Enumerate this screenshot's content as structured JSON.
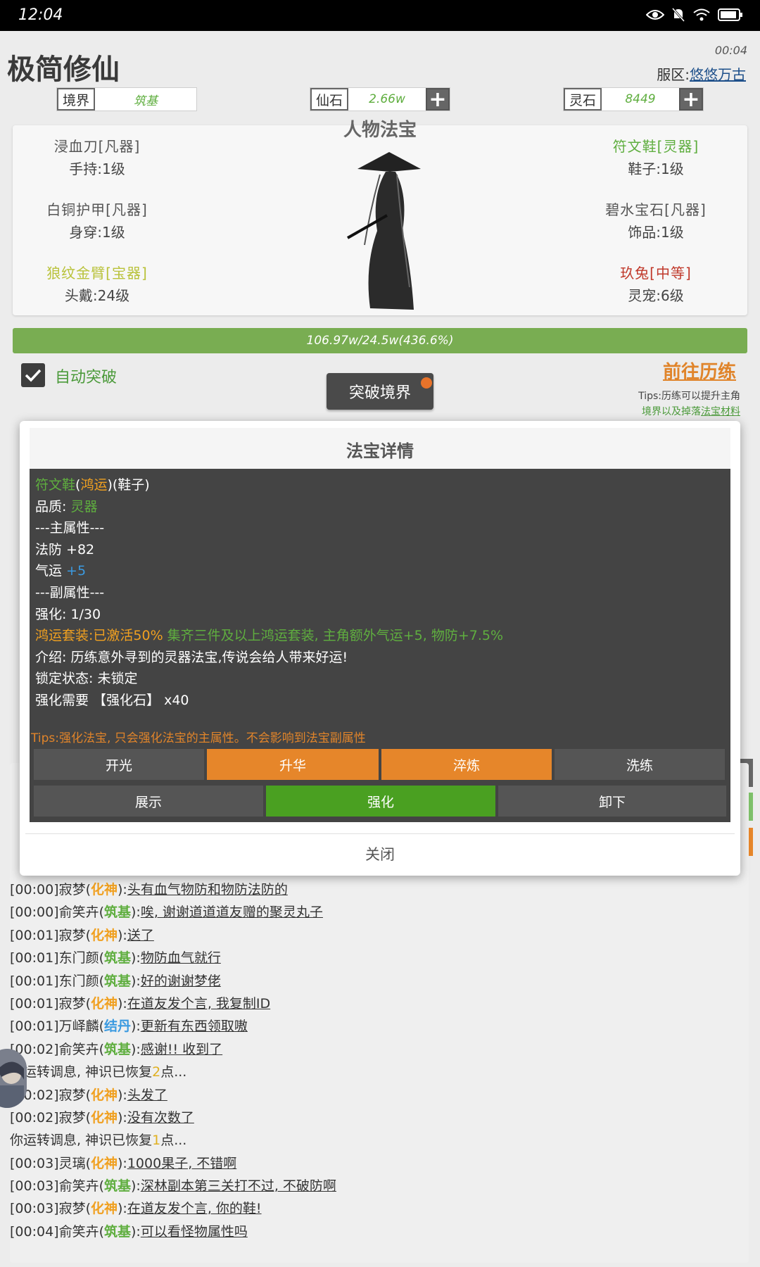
{
  "status_bar": {
    "time": "12:04"
  },
  "header": {
    "title": "极简修仙",
    "timer": "00:04",
    "server_label": "服区:",
    "server_name": "悠悠万古"
  },
  "resources": {
    "realm": {
      "label": "境界",
      "value": "筑基",
      "color": "#5fae3f"
    },
    "xian_stone": {
      "label": "仙石",
      "value": "2.66w",
      "color": "#5fae3f"
    },
    "ling_stone": {
      "label": "灵石",
      "value": "8449",
      "color": "#5fae3f"
    }
  },
  "equipment": {
    "title": "人物法宝",
    "items": [
      {
        "name": "浸血刀[凡器]",
        "slot": "手持:1级",
        "color": "#555555"
      },
      {
        "name": "白铜护甲[凡器]",
        "slot": "身穿:1级",
        "color": "#555555"
      },
      {
        "name": "狼纹金臂[宝器]",
        "slot": "头戴:24级",
        "color": "#b9c23a"
      },
      {
        "name": "符文鞋[灵器]",
        "slot": "鞋子:1级",
        "color": "#5fae3f"
      },
      {
        "name": "碧水宝石[凡器]",
        "slot": "饰品:1级",
        "color": "#555555"
      },
      {
        "name": "玖兔[中等]",
        "slot": "灵宠:6级",
        "color": "#c0392b"
      }
    ]
  },
  "progress": {
    "text": "106.97w/24.5w(436.6%)",
    "fraction": 1.0
  },
  "actions": {
    "auto_breakthrough": "自动突破",
    "auto_checked": true,
    "breakthrough_button": "突破境界",
    "goto_training": "前往历练",
    "tips_line1": "Tips:历练可以提升主角",
    "tips_line2a": "境界以及掉落",
    "tips_line2b": "法宝材料"
  },
  "modal": {
    "title": "法宝详情",
    "lines": [
      {
        "segments": [
          {
            "t": "符文鞋",
            "c": "#5fae3f"
          },
          {
            "t": "(",
            "c": "#ffffff"
          },
          {
            "t": "鸿运",
            "c": "#f0a020"
          },
          {
            "t": ")(鞋子)",
            "c": "#ffffff"
          }
        ]
      },
      {
        "segments": [
          {
            "t": "品质: ",
            "c": "#ffffff"
          },
          {
            "t": "灵器",
            "c": "#5fae3f"
          }
        ]
      },
      {
        "segments": [
          {
            "t": "---主属性---",
            "c": "#ffffff"
          }
        ]
      },
      {
        "segments": [
          {
            "t": "法防 +82",
            "c": "#ffffff"
          }
        ]
      },
      {
        "segments": [
          {
            "t": "气运 ",
            "c": "#ffffff"
          },
          {
            "t": "+5",
            "c": "#3b9ae0"
          }
        ]
      },
      {
        "segments": [
          {
            "t": "---副属性---",
            "c": "#ffffff"
          }
        ]
      },
      {
        "segments": [
          {
            "t": "强化: 1/30",
            "c": "#ffffff"
          }
        ]
      },
      {
        "segments": [
          {
            "t": "鸿运套装:已激活50% ",
            "c": "#f0a020"
          },
          {
            "t": "集齐三件及以上鸿运套装, 主角额外气运+5, 物防+7.5%",
            "c": "#5fae3f"
          }
        ]
      },
      {
        "segments": [
          {
            "t": "介绍: 历练意外寻到的灵器法宝,传说会给人带来好运!",
            "c": "#ffffff"
          }
        ]
      },
      {
        "segments": [
          {
            "t": "锁定状态: 未锁定",
            "c": "#ffffff"
          }
        ]
      },
      {
        "segments": [
          {
            "t": "强化需要 【强化石】 x40",
            "c": "#ffffff"
          }
        ]
      }
    ],
    "tips": "Tips:强化法宝, 只会强化法宝的主属性。不会影响到法宝副属性",
    "buttons_row1": [
      "开光",
      "升华",
      "淬炼",
      "洗练"
    ],
    "buttons_row2": [
      "展示",
      "强化",
      "卸下"
    ],
    "close": "关闭",
    "colors": {
      "orange": "#e6862a",
      "green": "#4aa021",
      "gray": "#555555"
    }
  },
  "chat": {
    "lines": [
      {
        "prefix": "[00:00]寂梦(",
        "realm": "化神",
        "realm_color": "#f0a020",
        "suffix": "):",
        "msg": "头有血气物防和物防法防的"
      },
      {
        "prefix": "[00:00]俞笑卉(",
        "realm": "筑基",
        "realm_color": "#5fae3f",
        "suffix": "):",
        "msg": "唉, 谢谢道道道友赠的聚灵丸子"
      },
      {
        "prefix": "[00:01]寂梦(",
        "realm": "化神",
        "realm_color": "#f0a020",
        "suffix": "):",
        "msg": "送了"
      },
      {
        "prefix": "[00:01]东门颜(",
        "realm": "筑基",
        "realm_color": "#5fae3f",
        "suffix": "):",
        "msg": "物防血气就行"
      },
      {
        "prefix": "[00:01]东门颜(",
        "realm": "筑基",
        "realm_color": "#5fae3f",
        "suffix": "):",
        "msg": "好的谢谢梦佬"
      },
      {
        "prefix": "[00:01]寂梦(",
        "realm": "化神",
        "realm_color": "#f0a020",
        "suffix": "):",
        "msg": "在道友发个言, 我复制ID"
      },
      {
        "prefix": "[00:01]万峄麟(",
        "realm": "结丹",
        "realm_color": "#3b9ae0",
        "suffix": "):",
        "msg": "更新有东西领取嗷"
      },
      {
        "prefix": "[00:02]俞笑卉(",
        "realm": "筑基",
        "realm_color": "#5fae3f",
        "suffix": "):",
        "msg": "感谢!! 收到了"
      },
      {
        "system": true,
        "a": "你运转调息, 神识已恢复",
        "n": "2",
        "b": "点..."
      },
      {
        "prefix": "[00:02]寂梦(",
        "realm": "化神",
        "realm_color": "#f0a020",
        "suffix": "):",
        "msg": "头发了"
      },
      {
        "prefix": "[00:02]寂梦(",
        "realm": "化神",
        "realm_color": "#f0a020",
        "suffix": "):",
        "msg": "没有次数了"
      },
      {
        "system": true,
        "a": "你运转调息, 神识已恢复",
        "n": "1",
        "b": "点..."
      },
      {
        "prefix": "[00:03]灵璃(",
        "realm": "化神",
        "realm_color": "#f0a020",
        "suffix": "):",
        "msg": "1000果子, 不错啊"
      },
      {
        "prefix": "[00:03]俞笑卉(",
        "realm": "筑基",
        "realm_color": "#5fae3f",
        "suffix": "):",
        "msg": "深林副本第三关打不过, 不破防啊"
      },
      {
        "prefix": "[00:03]寂梦(",
        "realm": "化神",
        "realm_color": "#f0a020",
        "suffix": "):",
        "msg": "在道友发个言, 你的鞋!"
      },
      {
        "prefix": "[00:04]俞笑卉(",
        "realm": "筑基",
        "realm_color": "#5fae3f",
        "suffix": "):",
        "msg": "可以看怪物属性吗"
      }
    ]
  }
}
